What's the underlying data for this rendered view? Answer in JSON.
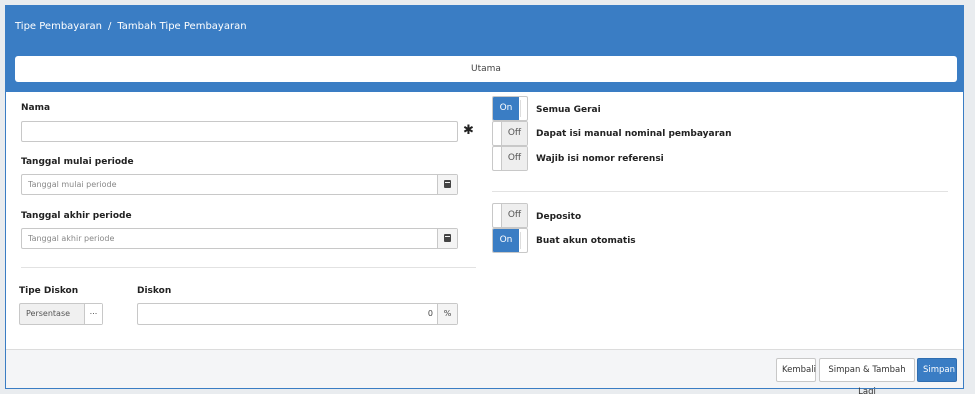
{
  "breadcrumb": {
    "parent": "Tipe Pembayaran",
    "separator": "/",
    "current": "Tambah Tipe Pembayaran"
  },
  "tabs": [
    {
      "label": "Utama"
    }
  ],
  "form": {
    "nama": {
      "label": "Nama",
      "value": "",
      "required_mark": "✱"
    },
    "tanggal_mulai": {
      "label": "Tanggal mulai periode",
      "placeholder": "Tanggal mulai periode"
    },
    "tanggal_akhir": {
      "label": "Tanggal akhir periode",
      "placeholder": "Tanggal akhir periode"
    },
    "tipe_diskon": {
      "label": "Tipe Diskon",
      "value": "Persentase",
      "button": "..."
    },
    "diskon": {
      "label": "Diskon",
      "value": "0",
      "suffix": "%"
    }
  },
  "toggles": [
    {
      "label": "Semua Gerai",
      "state": "On"
    },
    {
      "label": "Dapat isi manual nominal pembayaran",
      "state": "Off"
    },
    {
      "label": "Wajib isi nomor referensi",
      "state": "Off"
    },
    {
      "label": "Deposito",
      "state": "Off"
    },
    {
      "label": "Buat akun otomatis",
      "state": "On"
    }
  ],
  "footer": {
    "back_label": "Kembali",
    "save_add_label": "Simpan & Tambah Lagi",
    "save_label": "Simpan"
  },
  "colors": {
    "primary": "#3a7dc4",
    "border": "#c8c8c8",
    "background": "#e9ecef"
  }
}
